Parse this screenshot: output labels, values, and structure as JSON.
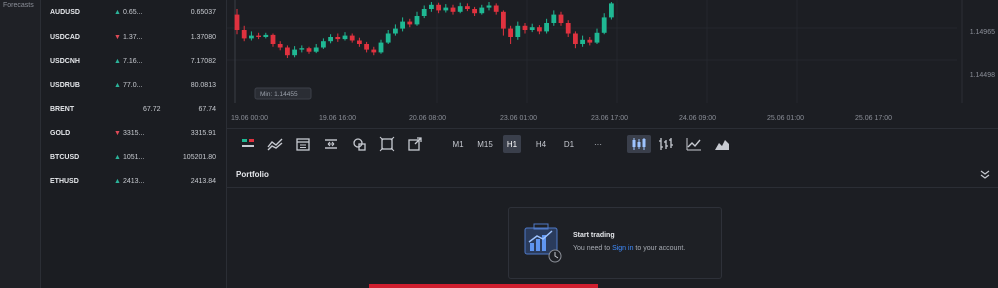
{
  "left_rail": {
    "label": "Forecasts"
  },
  "watchlist": {
    "rows": [
      {
        "symbol": "AUDUSD",
        "direction": "up",
        "bid": "0.65...",
        "ask": "0.65037"
      },
      {
        "symbol": "USDCAD",
        "direction": "down",
        "bid": "1.37...",
        "ask": "1.37080"
      },
      {
        "symbol": "USDCNH",
        "direction": "up",
        "bid": "7.16...",
        "ask": "7.17082"
      },
      {
        "symbol": "USDRUB",
        "direction": "up",
        "bid": "77.0...",
        "ask": "80.0813"
      },
      {
        "symbol": "BRENT",
        "direction": "none",
        "bid": "67.72",
        "ask": "67.74"
      },
      {
        "symbol": "GOLD",
        "direction": "down",
        "bid": "3315...",
        "ask": "3315.91"
      },
      {
        "symbol": "BTCUSD",
        "direction": "up",
        "bid": "1051...",
        "ask": "105201.80"
      },
      {
        "symbol": "ETHUSD",
        "direction": "up",
        "bid": "2413...",
        "ask": "2413.84"
      }
    ]
  },
  "chart": {
    "min_label": "Min: 1.14455",
    "price_labels": [
      "1.14965",
      "1.14498"
    ],
    "time_labels": [
      "19.06 00:00",
      "19.06 16:00",
      "20.06 08:00",
      "23.06 01:00",
      "23.06 17:00",
      "24.06 09:00",
      "25.06 01:00",
      "25.06 17:00"
    ]
  },
  "chart_data": {
    "type": "candlestick",
    "title": "",
    "xlabel": "",
    "ylabel": "",
    "x_tick_labels": [
      "19.06 00:00",
      "19.06 16:00",
      "20.06 08:00",
      "23.06 01:00",
      "23.06 17:00",
      "24.06 09:00",
      "25.06 01:00",
      "25.06 17:00"
    ],
    "y_tick_labels": [
      "1.14965",
      "1.14498"
    ],
    "annotation": "Min: 1.14455",
    "colors": {
      "up": "#1fb893",
      "down": "#e0323f"
    },
    "candles": [
      {
        "o": 0.82,
        "c": 0.6,
        "h": 0.9,
        "l": 0.54
      },
      {
        "o": 0.6,
        "c": 0.48,
        "h": 0.66,
        "l": 0.44
      },
      {
        "o": 0.48,
        "c": 0.52,
        "h": 0.58,
        "l": 0.45
      },
      {
        "o": 0.52,
        "c": 0.5,
        "h": 0.56,
        "l": 0.47
      },
      {
        "o": 0.5,
        "c": 0.53,
        "h": 0.56,
        "l": 0.48
      },
      {
        "o": 0.53,
        "c": 0.4,
        "h": 0.55,
        "l": 0.36
      },
      {
        "o": 0.4,
        "c": 0.35,
        "h": 0.44,
        "l": 0.31
      },
      {
        "o": 0.35,
        "c": 0.24,
        "h": 0.38,
        "l": 0.2
      },
      {
        "o": 0.24,
        "c": 0.32,
        "h": 0.37,
        "l": 0.21
      },
      {
        "o": 0.32,
        "c": 0.34,
        "h": 0.38,
        "l": 0.28
      },
      {
        "o": 0.34,
        "c": 0.29,
        "h": 0.36,
        "l": 0.26
      },
      {
        "o": 0.29,
        "c": 0.35,
        "h": 0.4,
        "l": 0.27
      },
      {
        "o": 0.35,
        "c": 0.44,
        "h": 0.48,
        "l": 0.33
      },
      {
        "o": 0.44,
        "c": 0.5,
        "h": 0.54,
        "l": 0.41
      },
      {
        "o": 0.5,
        "c": 0.47,
        "h": 0.55,
        "l": 0.43
      },
      {
        "o": 0.47,
        "c": 0.52,
        "h": 0.57,
        "l": 0.45
      },
      {
        "o": 0.52,
        "c": 0.45,
        "h": 0.55,
        "l": 0.42
      },
      {
        "o": 0.45,
        "c": 0.4,
        "h": 0.49,
        "l": 0.36
      },
      {
        "o": 0.4,
        "c": 0.32,
        "h": 0.43,
        "l": 0.28
      },
      {
        "o": 0.32,
        "c": 0.28,
        "h": 0.36,
        "l": 0.24
      },
      {
        "o": 0.28,
        "c": 0.42,
        "h": 0.46,
        "l": 0.26
      },
      {
        "o": 0.42,
        "c": 0.55,
        "h": 0.6,
        "l": 0.4
      },
      {
        "o": 0.55,
        "c": 0.62,
        "h": 0.68,
        "l": 0.52
      },
      {
        "o": 0.62,
        "c": 0.72,
        "h": 0.78,
        "l": 0.58
      },
      {
        "o": 0.72,
        "c": 0.68,
        "h": 0.76,
        "l": 0.64
      },
      {
        "o": 0.68,
        "c": 0.8,
        "h": 0.86,
        "l": 0.66
      },
      {
        "o": 0.8,
        "c": 0.9,
        "h": 0.95,
        "l": 0.77
      },
      {
        "o": 0.9,
        "c": 0.96,
        "h": 1.0,
        "l": 0.86
      },
      {
        "o": 0.96,
        "c": 0.88,
        "h": 0.99,
        "l": 0.84
      },
      {
        "o": 0.88,
        "c": 0.92,
        "h": 0.97,
        "l": 0.85
      },
      {
        "o": 0.92,
        "c": 0.86,
        "h": 0.96,
        "l": 0.82
      },
      {
        "o": 0.86,
        "c": 0.94,
        "h": 0.99,
        "l": 0.84
      },
      {
        "o": 0.94,
        "c": 0.9,
        "h": 0.98,
        "l": 0.87
      },
      {
        "o": 0.9,
        "c": 0.84,
        "h": 0.93,
        "l": 0.8
      },
      {
        "o": 0.84,
        "c": 0.92,
        "h": 0.96,
        "l": 0.82
      },
      {
        "o": 0.92,
        "c": 0.95,
        "h": 1.0,
        "l": 0.88
      },
      {
        "o": 0.95,
        "c": 0.86,
        "h": 0.98,
        "l": 0.82
      },
      {
        "o": 0.86,
        "c": 0.62,
        "h": 0.88,
        "l": 0.52
      },
      {
        "o": 0.62,
        "c": 0.5,
        "h": 0.66,
        "l": 0.4
      },
      {
        "o": 0.5,
        "c": 0.66,
        "h": 0.72,
        "l": 0.46
      },
      {
        "o": 0.66,
        "c": 0.6,
        "h": 0.7,
        "l": 0.55
      },
      {
        "o": 0.6,
        "c": 0.64,
        "h": 0.69,
        "l": 0.57
      },
      {
        "o": 0.64,
        "c": 0.58,
        "h": 0.67,
        "l": 0.54
      },
      {
        "o": 0.58,
        "c": 0.7,
        "h": 0.76,
        "l": 0.55
      },
      {
        "o": 0.7,
        "c": 0.82,
        "h": 0.88,
        "l": 0.66
      },
      {
        "o": 0.82,
        "c": 0.7,
        "h": 0.86,
        "l": 0.66
      },
      {
        "o": 0.7,
        "c": 0.55,
        "h": 0.74,
        "l": 0.5
      },
      {
        "o": 0.55,
        "c": 0.4,
        "h": 0.58,
        "l": 0.34
      },
      {
        "o": 0.4,
        "c": 0.46,
        "h": 0.52,
        "l": 0.36
      },
      {
        "o": 0.46,
        "c": 0.42,
        "h": 0.5,
        "l": 0.38
      },
      {
        "o": 0.42,
        "c": 0.56,
        "h": 0.62,
        "l": 0.4
      },
      {
        "o": 0.56,
        "c": 0.78,
        "h": 0.84,
        "l": 0.54
      },
      {
        "o": 0.78,
        "c": 0.98,
        "h": 1.0,
        "l": 0.75
      }
    ]
  },
  "toolbar": {
    "timeframes": [
      {
        "label": "M1",
        "active": false
      },
      {
        "label": "M15",
        "active": false
      },
      {
        "label": "H1",
        "active": true
      },
      {
        "label": "H4",
        "active": false
      },
      {
        "label": "D1",
        "active": false
      },
      {
        "label": "···",
        "active": false
      }
    ]
  },
  "portfolio": {
    "title": "Portfolio",
    "empty_title": "Start trading",
    "empty_text_before": "You need to ",
    "empty_link": "Sign in",
    "empty_text_after": " to your account."
  }
}
